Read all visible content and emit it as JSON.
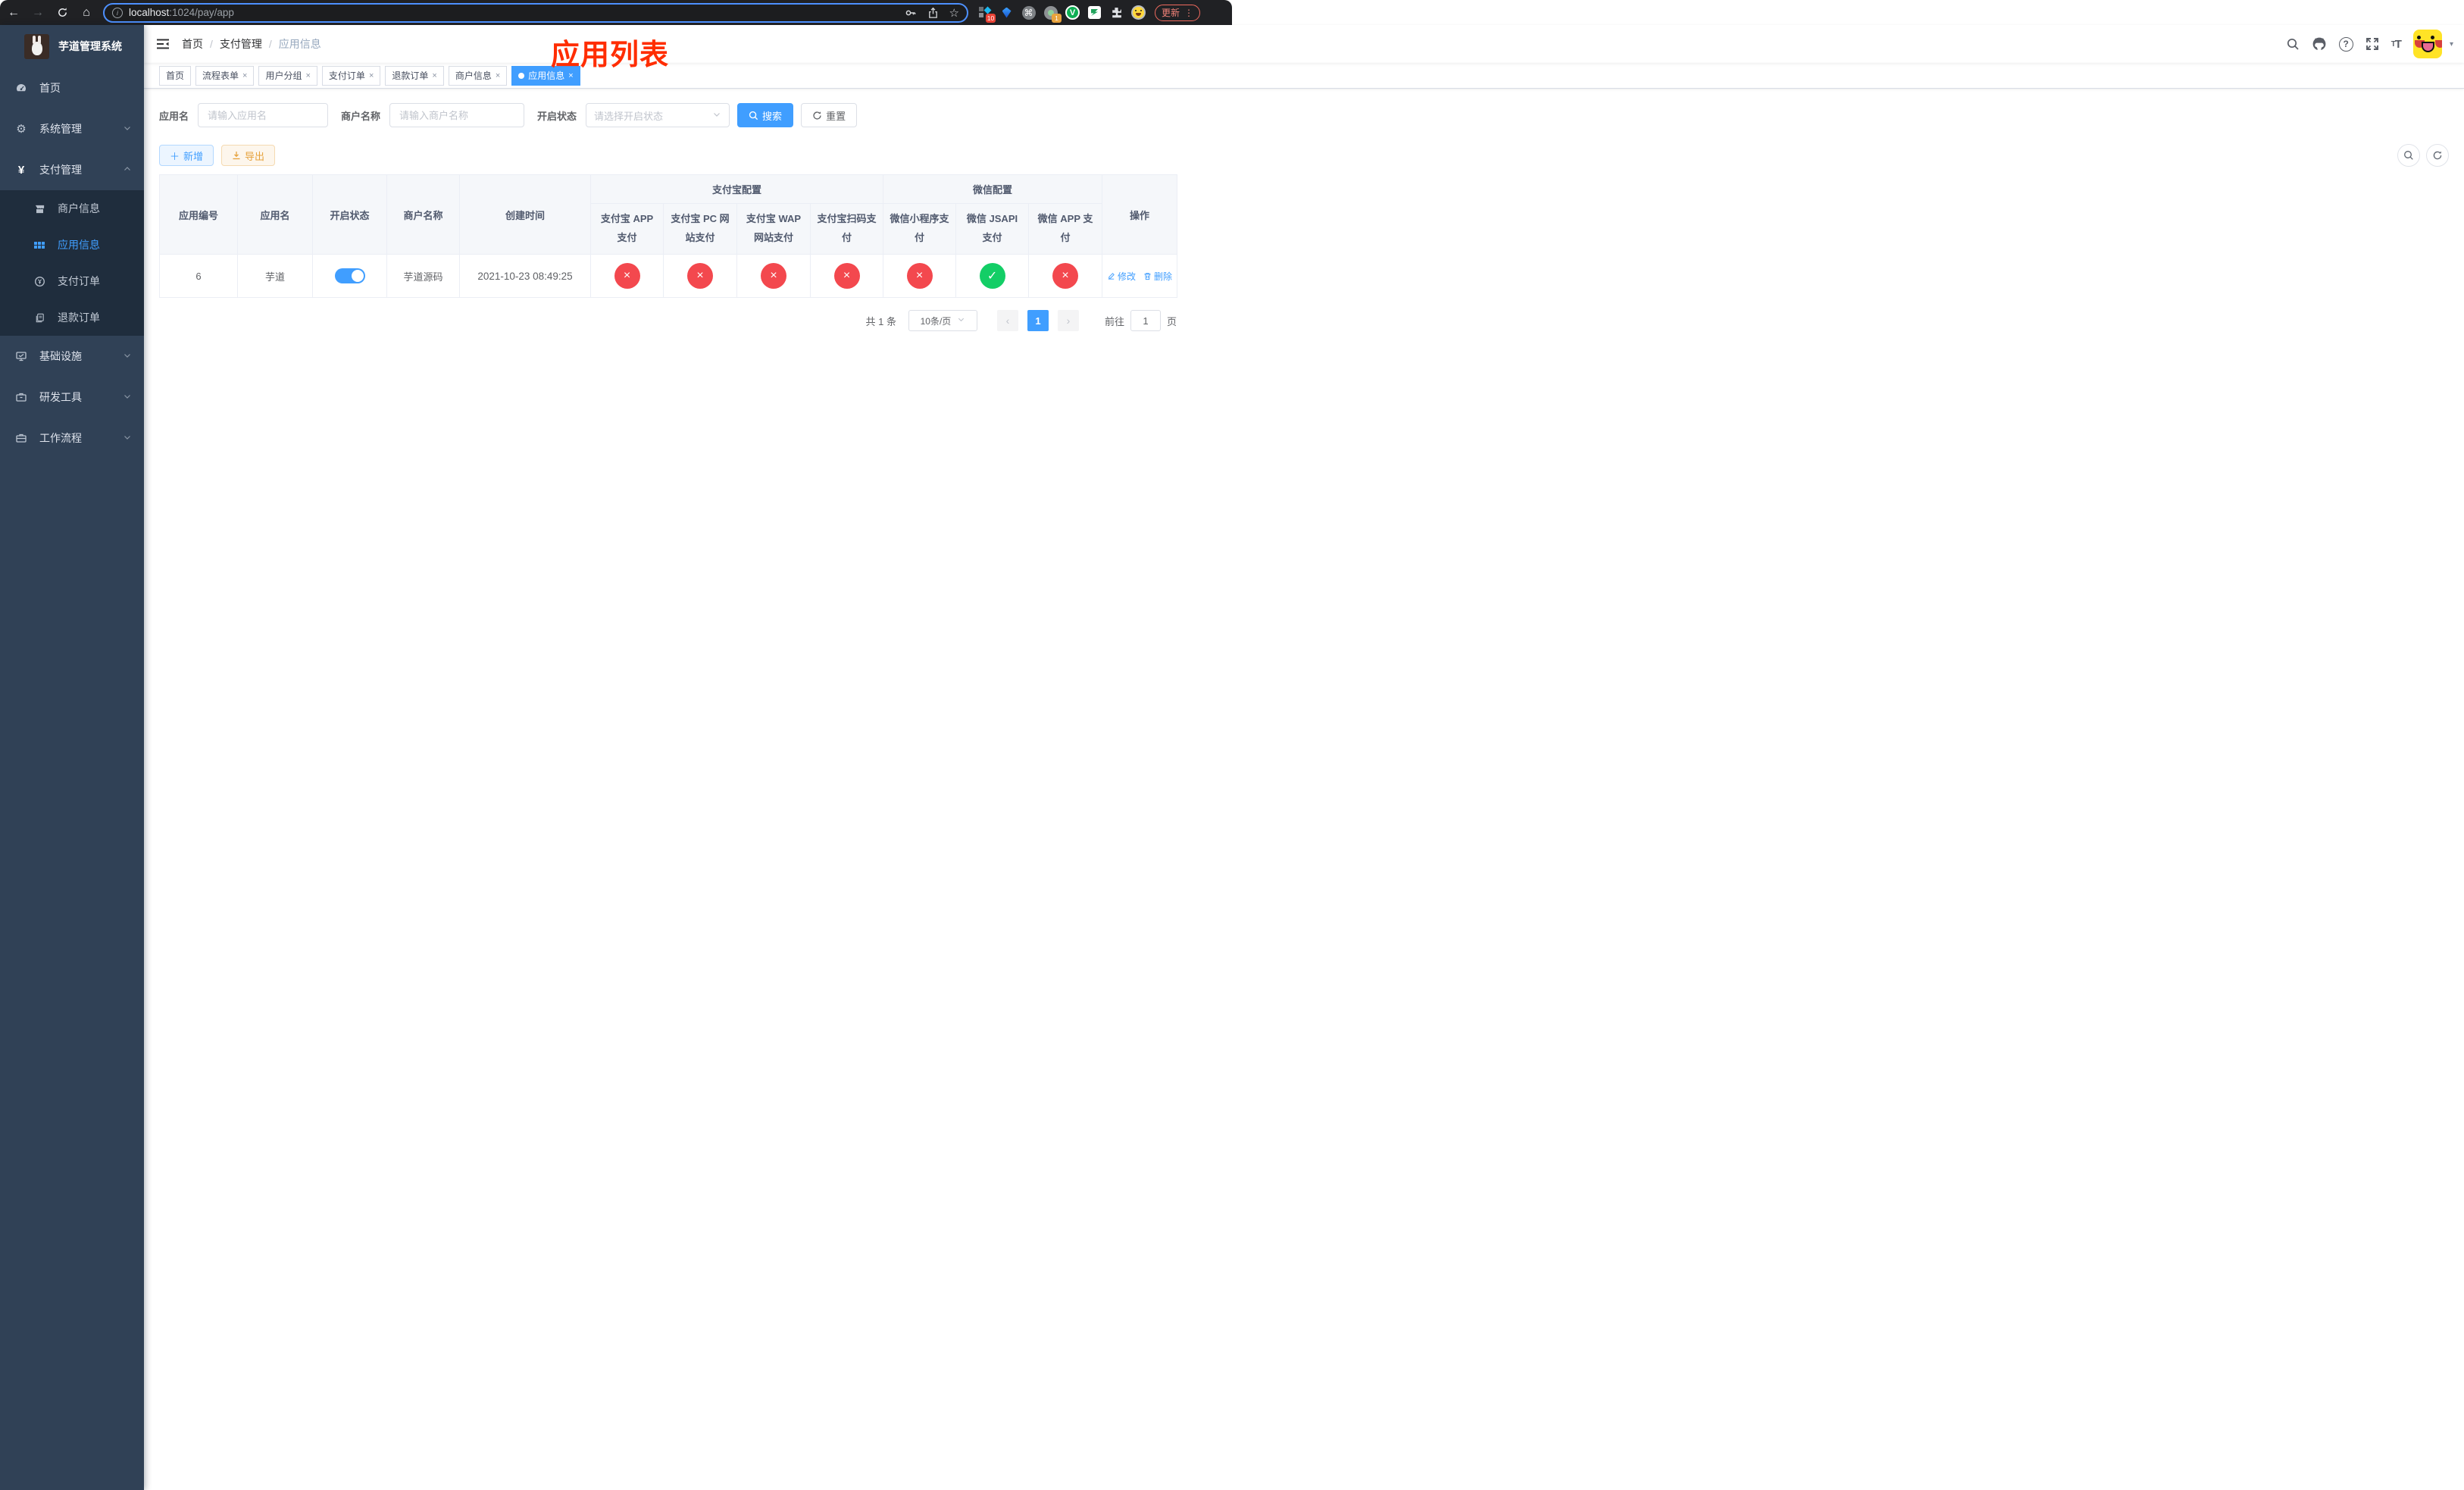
{
  "browser": {
    "url_host": "localhost",
    "url_path": ":1024/pay/app",
    "update_label": "更新",
    "ext_badge_blue_diamond": "10",
    "ext_badge_gray_circle": "1",
    "ext_v_letter": "V"
  },
  "sidebar": {
    "title": "芋道管理系统",
    "items": [
      {
        "label": "首页"
      },
      {
        "label": "系统管理"
      },
      {
        "label": "支付管理"
      },
      {
        "label": "基础设施"
      },
      {
        "label": "研发工具"
      },
      {
        "label": "工作流程"
      }
    ],
    "submenu": [
      {
        "label": "商户信息"
      },
      {
        "label": "应用信息"
      },
      {
        "label": "支付订单"
      },
      {
        "label": "退款订单"
      }
    ]
  },
  "navbar": {
    "breadcrumb": [
      "首页",
      "支付管理",
      "应用信息"
    ],
    "annotation": "应用列表",
    "annotation_color": "#ff2d00"
  },
  "tags": [
    {
      "label": "首页"
    },
    {
      "label": "流程表单"
    },
    {
      "label": "用户分组"
    },
    {
      "label": "支付订单"
    },
    {
      "label": "退款订单"
    },
    {
      "label": "商户信息"
    },
    {
      "label": "应用信息"
    }
  ],
  "filters": {
    "app_name_label": "应用名",
    "app_name_placeholder": "请输入应用名",
    "merchant_label": "商户名称",
    "merchant_placeholder": "请输入商户名称",
    "status_label": "开启状态",
    "status_placeholder": "请选择开启状态",
    "search_label": "搜索",
    "reset_label": "重置"
  },
  "toolbar": {
    "add_label": "新增",
    "export_label": "导出"
  },
  "table": {
    "headers": {
      "app_id": "应用编号",
      "app_name": "应用名",
      "open_status": "开启状态",
      "merchant_name": "商户名称",
      "create_time": "创建时间",
      "alipay_group": "支付宝配置",
      "wechat_group": "微信配置",
      "actions": "操作",
      "alipay_cols": [
        "支付宝 APP 支付",
        "支付宝 PC 网站支付",
        "支付宝 WAP 网站支付",
        "支付宝扫码支付"
      ],
      "wechat_cols": [
        "微信小程序支付",
        "微信 JSAPI 支付",
        "微信 APP 支付"
      ]
    },
    "rows": [
      {
        "app_id": "6",
        "app_name": "芋道",
        "open_status": true,
        "merchant_name": "芋道源码",
        "create_time": "2021-10-23 08:49:25",
        "pay_status": [
          "no",
          "no",
          "no",
          "no",
          "no",
          "yes",
          "no"
        ],
        "edit_label": "修改",
        "delete_label": "删除"
      }
    ]
  },
  "pagination": {
    "total": "共 1 条",
    "page_size": "10条/页",
    "current_page": "1",
    "goto_label": "前往",
    "goto_value": "1",
    "page_suffix": "页"
  },
  "colors": {
    "accent": "#409EFF",
    "success": "#13ce66",
    "danger": "#f3484e",
    "warning": "#e6a23c",
    "sidebar_bg": "#304156",
    "submenu_bg": "#1f2d3d",
    "annotation": "#ff2d00",
    "browser_bar": "#202124"
  }
}
